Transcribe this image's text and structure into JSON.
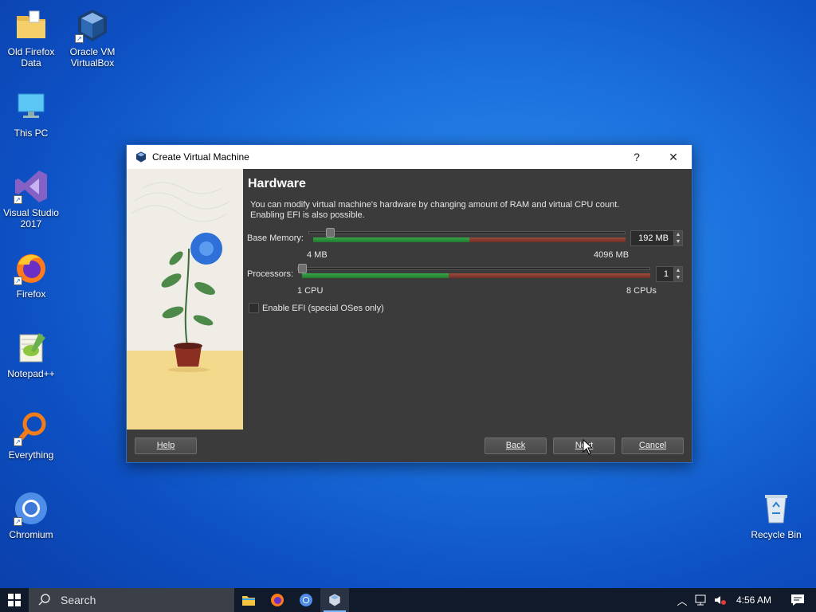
{
  "desktop": {
    "icons": [
      {
        "label": "Old Firefox Data"
      },
      {
        "label": "Oracle VM VirtualBox"
      },
      {
        "label": "This PC"
      },
      {
        "label": "Visual Studio 2017"
      },
      {
        "label": "Firefox"
      },
      {
        "label": "Notepad++"
      },
      {
        "label": "Everything"
      },
      {
        "label": "Chromium"
      },
      {
        "label": "Recycle Bin"
      }
    ]
  },
  "dialog": {
    "title": "Create Virtual Machine",
    "help_glyph": "?",
    "close_glyph": "✕",
    "heading": "Hardware",
    "description": "You can modify virtual machine's hardware by changing amount of RAM and virtual CPU count. Enabling EFI is also possible.",
    "memory": {
      "label": "Base Memory:",
      "min_label": "4 MB",
      "max_label": "4096 MB",
      "value": "192 MB",
      "fraction": 0.045
    },
    "processors": {
      "label": "Processors:",
      "min_label": "1 CPU",
      "max_label": "8 CPUs",
      "value": "1",
      "fraction": 0.0
    },
    "efi_label": "Enable EFI (special OSes only)",
    "buttons": {
      "help": "Help",
      "back": "Back",
      "next": "Next",
      "cancel": "Cancel"
    }
  },
  "taskbar": {
    "search_placeholder": "Search",
    "clock": "4:56 AM"
  },
  "colors": {
    "accent": "#2a6ac9",
    "dialog_bg": "#3b3b3b",
    "meter_green": "#3aa54a",
    "meter_red": "#9b4b3d"
  }
}
